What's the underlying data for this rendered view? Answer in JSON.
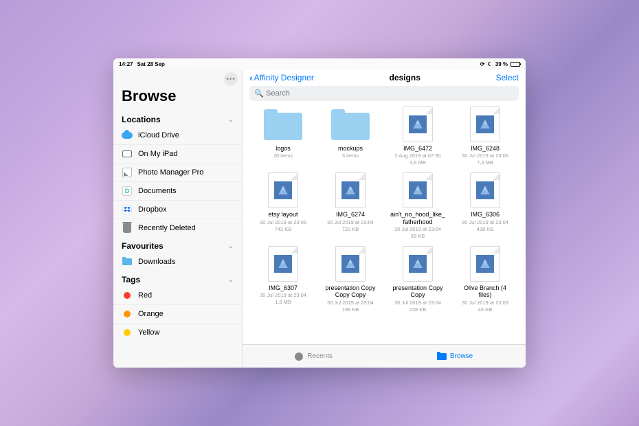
{
  "status": {
    "time": "14:27",
    "date": "Sat 28 Sep",
    "battery_pct": "39 %"
  },
  "sidebar": {
    "title": "Browse",
    "sections": {
      "locations": {
        "header": "Locations",
        "items": [
          "iCloud Drive",
          "On My iPad",
          "Photo Manager Pro",
          "Documents",
          "Dropbox",
          "Recently Deleted"
        ]
      },
      "favourites": {
        "header": "Favourites",
        "items": [
          "Downloads"
        ]
      },
      "tags": {
        "header": "Tags",
        "items": [
          {
            "label": "Red",
            "color": "#ff3b30"
          },
          {
            "label": "Orange",
            "color": "#ff9500"
          },
          {
            "label": "Yellow",
            "color": "#ffcc00"
          }
        ]
      }
    }
  },
  "main": {
    "back_label": "Affinity Designer",
    "title": "designs",
    "select_label": "Select",
    "search_placeholder": "Search",
    "items": [
      {
        "kind": "folder",
        "name": "logos",
        "meta1": "20 items",
        "meta2": ""
      },
      {
        "kind": "folder",
        "name": "mockups",
        "meta1": "3 items",
        "meta2": ""
      },
      {
        "kind": "file",
        "name": "IMG_6472",
        "meta1": "2 Aug 2019 at 07:50",
        "meta2": "3,6 MB"
      },
      {
        "kind": "file",
        "name": "IMG_6248",
        "meta1": "30 Jul 2019 at 23:06",
        "meta2": "7,4 MB"
      },
      {
        "kind": "file",
        "name": "etsy layout",
        "meta1": "30 Jul 2019 at 23:05",
        "meta2": "742 KB"
      },
      {
        "kind": "file",
        "name": "IMG_6274",
        "meta1": "30 Jul 2019 at 23:04",
        "meta2": "722 KB"
      },
      {
        "kind": "file",
        "name": "ain't_no_hood_like_fatherhood",
        "meta1": "30 Jul 2019 at 23:04",
        "meta2": "56 KB"
      },
      {
        "kind": "file",
        "name": "IMG_6306",
        "meta1": "30 Jul 2019 at 23:04",
        "meta2": "438 KB"
      },
      {
        "kind": "file",
        "name": "IMG_6307",
        "meta1": "30 Jul 2019 at 23:04",
        "meta2": "1,6 MB"
      },
      {
        "kind": "file",
        "name": "presentation Copy Copy Copy",
        "meta1": "30 Jul 2019 at 23:04",
        "meta2": "196 KB"
      },
      {
        "kind": "file",
        "name": "presentation Copy Copy",
        "meta1": "30 Jul 2019 at 23:04",
        "meta2": "228 KB"
      },
      {
        "kind": "file",
        "name": "Olive Branch (4 files)",
        "meta1": "30 Jul 2019 at 23:03",
        "meta2": "46 KB"
      }
    ]
  },
  "tabs": {
    "recents": "Recents",
    "browse": "Browse"
  }
}
